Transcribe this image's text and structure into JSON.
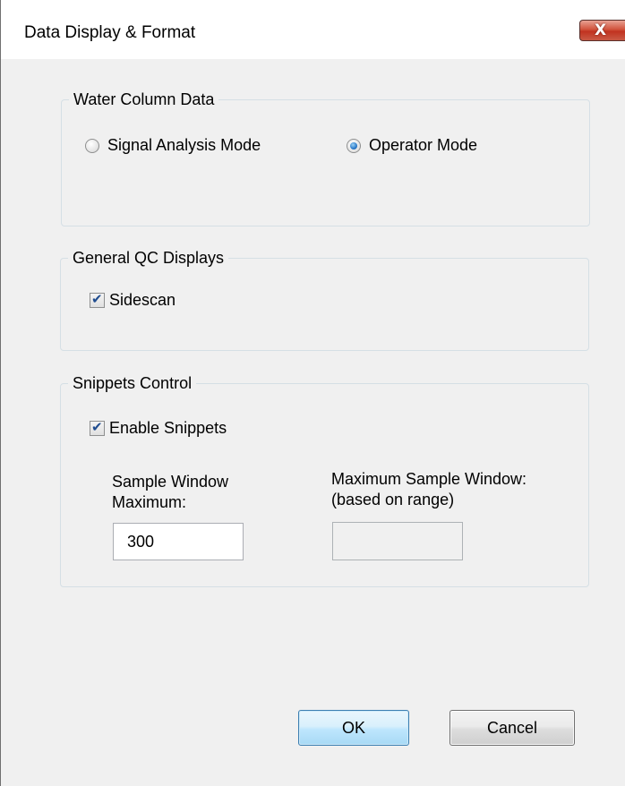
{
  "window": {
    "title": "Data Display & Format",
    "close_glyph": "X"
  },
  "water_column": {
    "legend": "Water Column Data",
    "options": [
      {
        "label": "Signal Analysis Mode",
        "selected": false
      },
      {
        "label": "Operator Mode",
        "selected": true
      }
    ]
  },
  "general_qc": {
    "legend": "General QC Displays",
    "sidescan": {
      "label": "Sidescan",
      "checked": true
    }
  },
  "snippets": {
    "legend": "Snippets Control",
    "enable": {
      "label": "Enable Snippets",
      "checked": true
    },
    "sample_window_label_line1": "Sample Window",
    "sample_window_label_line2": "Maximum:",
    "sample_window_value": "300",
    "max_sample_window_label_line1": "Maximum Sample Window:",
    "max_sample_window_label_line2": "(based on range)",
    "max_sample_window_value": ""
  },
  "buttons": {
    "ok": "OK",
    "cancel": "Cancel"
  },
  "icons": {
    "close": "close-icon",
    "radio": "radio-icon",
    "checkbox": "checkbox-icon"
  },
  "colors": {
    "dialog_bg": "#f0f0f0",
    "close_red": "#c13320",
    "ok_blue": "#3c7fb1"
  }
}
